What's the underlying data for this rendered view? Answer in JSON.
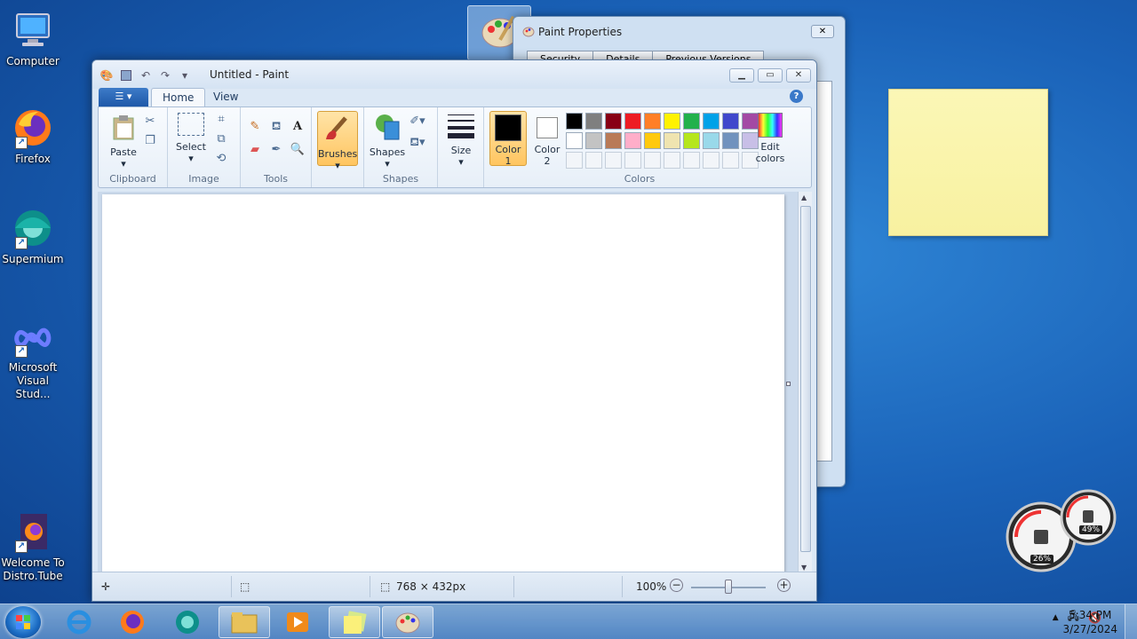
{
  "desktop": {
    "icons": [
      {
        "label": "Computer"
      },
      {
        "label": "Firefox"
      },
      {
        "label": "Supermium"
      },
      {
        "label": "Microsoft Visual Stud..."
      },
      {
        "label": "Welcome To Distro.Tube"
      }
    ]
  },
  "properties_dialog": {
    "title": "Paint Properties",
    "tabs": [
      "Security",
      "Details",
      "Previous Versions"
    ]
  },
  "paint": {
    "title": "Untitled - Paint",
    "tabs": {
      "home": "Home",
      "view": "View"
    },
    "groups": {
      "clipboard": "Clipboard",
      "image": "Image",
      "tools": "Tools",
      "shapes": "Shapes",
      "colors": "Colors"
    },
    "buttons": {
      "paste": "Paste",
      "select": "Select",
      "brushes": "Brushes",
      "shapes": "Shapes",
      "size": "Size",
      "color1_line1": "Color",
      "color1_line2": "1",
      "color2_line1": "Color",
      "color2_line2": "2",
      "edit_colors_line1": "Edit",
      "edit_colors_line2": "colors"
    },
    "palette_row1": [
      "#000000",
      "#7f7f7f",
      "#880015",
      "#ed1c24",
      "#ff7f27",
      "#fff200",
      "#22b14c",
      "#00a2e8",
      "#3f48cc",
      "#a349a4"
    ],
    "palette_row2": [
      "#ffffff",
      "#c3c3c3",
      "#b97a57",
      "#ffaec9",
      "#ffc90e",
      "#efe4b0",
      "#b5e61d",
      "#99d9ea",
      "#7092be",
      "#c8bfe7"
    ],
    "color1": "#000000",
    "color2": "#ffffff",
    "status": {
      "image_size": "768 × 432px",
      "zoom": "100%"
    }
  },
  "taskbar": {
    "time": "5:34 PM",
    "date": "3/27/2024"
  },
  "gadget": {
    "cpu": "26%",
    "mem": "49%"
  }
}
